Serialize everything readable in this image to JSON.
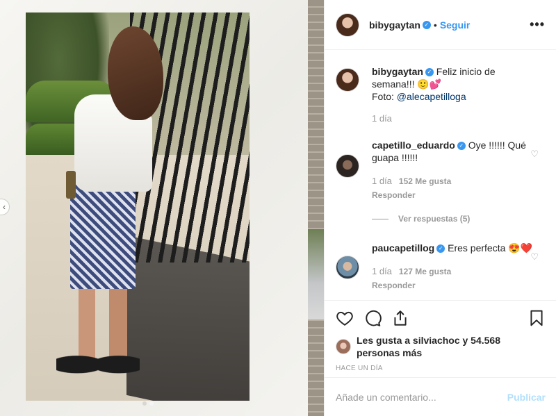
{
  "header": {
    "username": "bibygaytan",
    "separator": "•",
    "follow_label": "Seguir",
    "more_label": "•••"
  },
  "caption": {
    "username": "bibygaytan",
    "text": "Feliz inicio de semana!!! 🙂💕",
    "photo_prefix": "Foto: ",
    "mention": "@alecapetilloga",
    "time": "1 día"
  },
  "comments": [
    {
      "username": "capetillo_eduardo",
      "text": "Oye !!!!!! Qué guapa !!!!!!",
      "time": "1 día",
      "likes": "152 Me gusta",
      "reply_label": "Responder",
      "view_replies": "Ver respuestas (5)"
    },
    {
      "username": "paucapetillog",
      "text": "Eres perfecta 😍❤️",
      "time": "1 día",
      "likes": "127 Me gusta",
      "reply_label": "Responder"
    }
  ],
  "actions": {
    "icons": [
      "heart-icon",
      "comment-icon",
      "share-icon",
      "bookmark-icon"
    ],
    "likes_text": "Les gusta a silviachoc y 54.568 personas más",
    "timestamp": "HACE UN DÍA"
  },
  "comment_box": {
    "placeholder": "Añade un comentario...",
    "publish_label": "Publicar"
  },
  "colors": {
    "accent": "#3897f0",
    "publish_disabled": "#b2dffc",
    "muted": "#999999"
  }
}
